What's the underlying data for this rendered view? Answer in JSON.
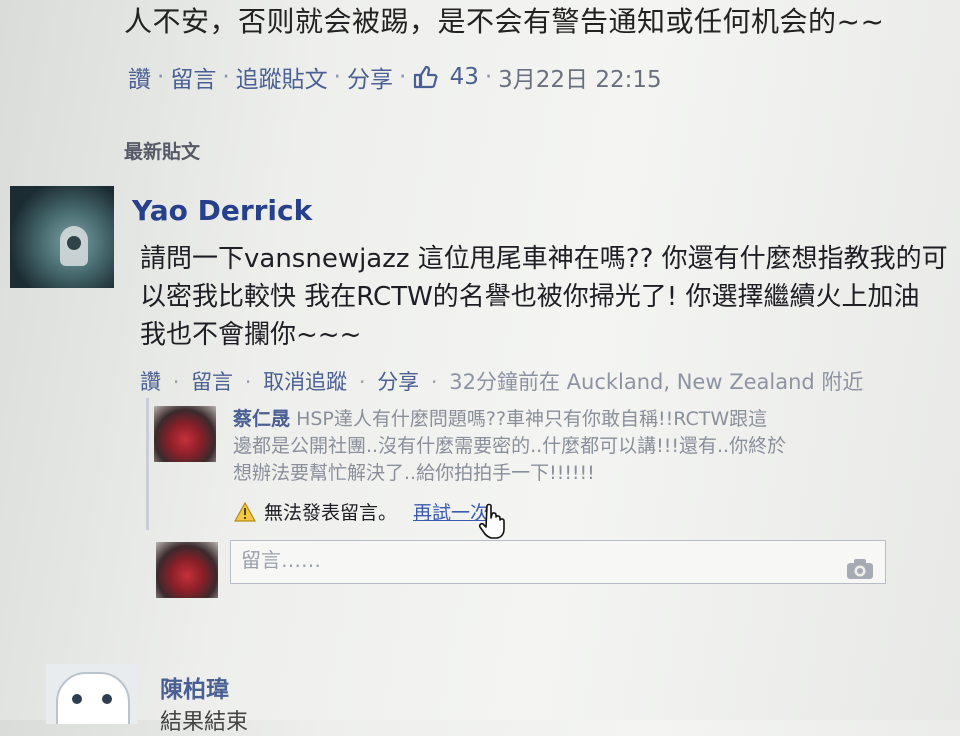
{
  "top_post": {
    "text_tail": "人不安，否则就会被踢，是不会有警告通知或任何机会的~~",
    "actions": [
      "讚",
      "留言",
      "追蹤貼文",
      "分享"
    ],
    "like_count": "43",
    "timestamp": "3月22日 22:15"
  },
  "section_title": "最新貼文",
  "post": {
    "author": "Yao Derrick",
    "lines": [
      "請問一下vansnewjazz 這位甩尾車神在嗎?? 你還有什麼想指教我的可",
      "以密我比較快 我在RCTW的名譽也被你掃光了! 你選擇繼續火上加油",
      "我也不會攔你~~~"
    ],
    "actions": [
      "讚",
      "留言",
      "取消追蹤",
      "分享"
    ],
    "meta": "32分鐘前在 Auckland, New Zealand 附近"
  },
  "comment": {
    "author": "蔡仁晟",
    "line1": "HSP達人有什麼問題嗎??車神只有你敢自稱!!RCTW跟這",
    "line2": "邊都是公開社團..沒有什麼需要密的..什麼都可以講!!!還有..你終於",
    "line3": "想辦法要幫忙解決了..給你拍拍手一下!!!!!!"
  },
  "error": {
    "message": "無法發表留言。",
    "retry_label": "再試一次"
  },
  "comment_input": {
    "placeholder": "留言……"
  },
  "next_post": {
    "author": "陳柏瑋",
    "text_start": "結果結束"
  },
  "colors": {
    "link": "#4a5f93",
    "author": "#27408b",
    "meta": "#8d93a3"
  }
}
